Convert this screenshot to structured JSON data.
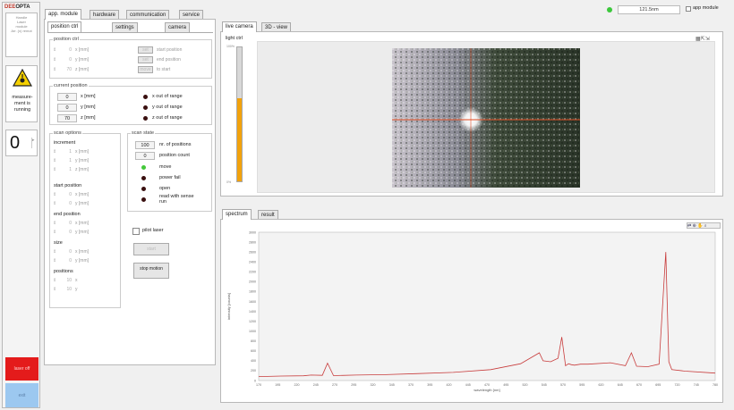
{
  "logo": {
    "part1": "DEE",
    "part2": "OPTA"
  },
  "status_box": {
    "lines": [
      "Handle",
      "Laser",
      "module",
      "",
      "Arr. (x) remot"
    ]
  },
  "laser_warning": {
    "label": "measure-ment is running"
  },
  "counter": {
    "value": "0"
  },
  "topbar": {
    "field_value": "121.5nm",
    "app_module_label": "app module"
  },
  "main_tabs": [
    {
      "label": "app. module"
    },
    {
      "label": "hardware"
    },
    {
      "label": "communication"
    },
    {
      "label": "service"
    }
  ],
  "sub_tabs": [
    {
      "label": "position ctrl"
    },
    {
      "label": "settings"
    },
    {
      "label": "camera"
    }
  ],
  "position_ctrl": {
    "title": "position ctrl",
    "rows": [
      {
        "value": "0",
        "unit": "x [mm]"
      },
      {
        "value": "0",
        "unit": "y [mm]"
      },
      {
        "value": "70",
        "unit": "z [mm]"
      }
    ],
    "buttons": [
      {
        "btn": "set",
        "label": "start position"
      },
      {
        "btn": "set",
        "label": "end position"
      },
      {
        "btn": "move",
        "label": "to start"
      }
    ]
  },
  "current_position": {
    "title": "current position",
    "rows": [
      {
        "value": "0",
        "unit": "x [mm]",
        "status": "x out of range"
      },
      {
        "value": "0",
        "unit": "y [mm]",
        "status": "y out of range"
      },
      {
        "value": "70",
        "unit": "z [mm]",
        "status": "z out of range"
      }
    ]
  },
  "scan_options": {
    "title": "scan options",
    "sections": [
      {
        "title": "increment",
        "rows": [
          {
            "value": "1",
            "unit": "x [mm]"
          },
          {
            "value": "1",
            "unit": "y [mm]"
          },
          {
            "value": "1",
            "unit": "z [mm]"
          }
        ]
      },
      {
        "title": "start position",
        "rows": [
          {
            "value": "0",
            "unit": "x [mm]"
          },
          {
            "value": "0",
            "unit": "y [mm]"
          }
        ]
      },
      {
        "title": "end position",
        "rows": [
          {
            "value": "0",
            "unit": "x [mm]"
          },
          {
            "value": "0",
            "unit": "y [mm]"
          }
        ]
      },
      {
        "title": "size",
        "rows": [
          {
            "value": "0",
            "unit": "x [mm]"
          },
          {
            "value": "0",
            "unit": "y [mm]"
          }
        ]
      },
      {
        "title": "positions",
        "rows": [
          {
            "value": "10",
            "unit": "x"
          },
          {
            "value": "10",
            "unit": "y"
          }
        ]
      }
    ]
  },
  "scan_state": {
    "title": "scan state",
    "count_rows": [
      {
        "value": "100",
        "label": "nr. of positions"
      },
      {
        "value": "0",
        "label": "position count"
      }
    ],
    "leds": [
      {
        "label": "move",
        "color": "#44c83a"
      },
      {
        "label": "power fail",
        "color": "#3a1010"
      },
      {
        "label": "open",
        "color": "#3a1010"
      },
      {
        "label": "read with sense run",
        "color": "#3a1010"
      }
    ]
  },
  "pilot_laser": {
    "label": "pilot laser"
  },
  "buttons": {
    "start_label": "start",
    "stop_label": "stop motion"
  },
  "side_buttons": {
    "red_label": "laser off",
    "blue_label": "exit"
  },
  "camera_tabs": [
    {
      "label": "live camera"
    },
    {
      "label": "3D - view"
    }
  ],
  "light_ctrl": {
    "label": "light ctrl",
    "top_value": "100%",
    "bottom_value": "0%",
    "level": 0.62
  },
  "spectrum_tabs": [
    {
      "label": "spectrum"
    },
    {
      "label": "result"
    }
  ],
  "colors": {
    "accent_orange": "#f2a20c",
    "spectrum_line": "#c83c3c",
    "panel_border": "#b8b8b8"
  },
  "chart_data": {
    "type": "line",
    "title": "",
    "xlabel": "wavelength [nm]",
    "ylabel": "intensity [counts]",
    "xlim": [
      170,
      780
    ],
    "ylim": [
      0,
      3000
    ],
    "x_ticks": [
      "170",
      "195",
      "220",
      "245",
      "270",
      "295",
      "320",
      "345",
      "370",
      "395",
      "420",
      "445",
      "470",
      "495",
      "520",
      "545",
      "570",
      "595",
      "620",
      "645",
      "670",
      "695",
      "720",
      "745",
      "780"
    ],
    "y_ticks": [
      "0",
      "200",
      "400",
      "600",
      "800",
      "1000",
      "1200",
      "1400",
      "1600",
      "1800",
      "2000",
      "2200",
      "2400",
      "2600",
      "2800",
      "3000"
    ],
    "series": [
      {
        "x": [
          170,
          200,
          230,
          240,
          255,
          262,
          270,
          300,
          340,
          380,
          430,
          480,
          520,
          545,
          550,
          560,
          570,
          575,
          580,
          584,
          588,
          592,
          600,
          610,
          640,
          660,
          668,
          675,
          690,
          705,
          714,
          718,
          722,
          740,
          780
        ],
        "y": [
          80,
          90,
          95,
          110,
          105,
          350,
          100,
          110,
          120,
          140,
          165,
          220,
          340,
          560,
          400,
          380,
          450,
          880,
          300,
          340,
          320,
          310,
          330,
          330,
          360,
          300,
          560,
          290,
          280,
          330,
          2600,
          380,
          220,
          190,
          150
        ]
      }
    ]
  }
}
